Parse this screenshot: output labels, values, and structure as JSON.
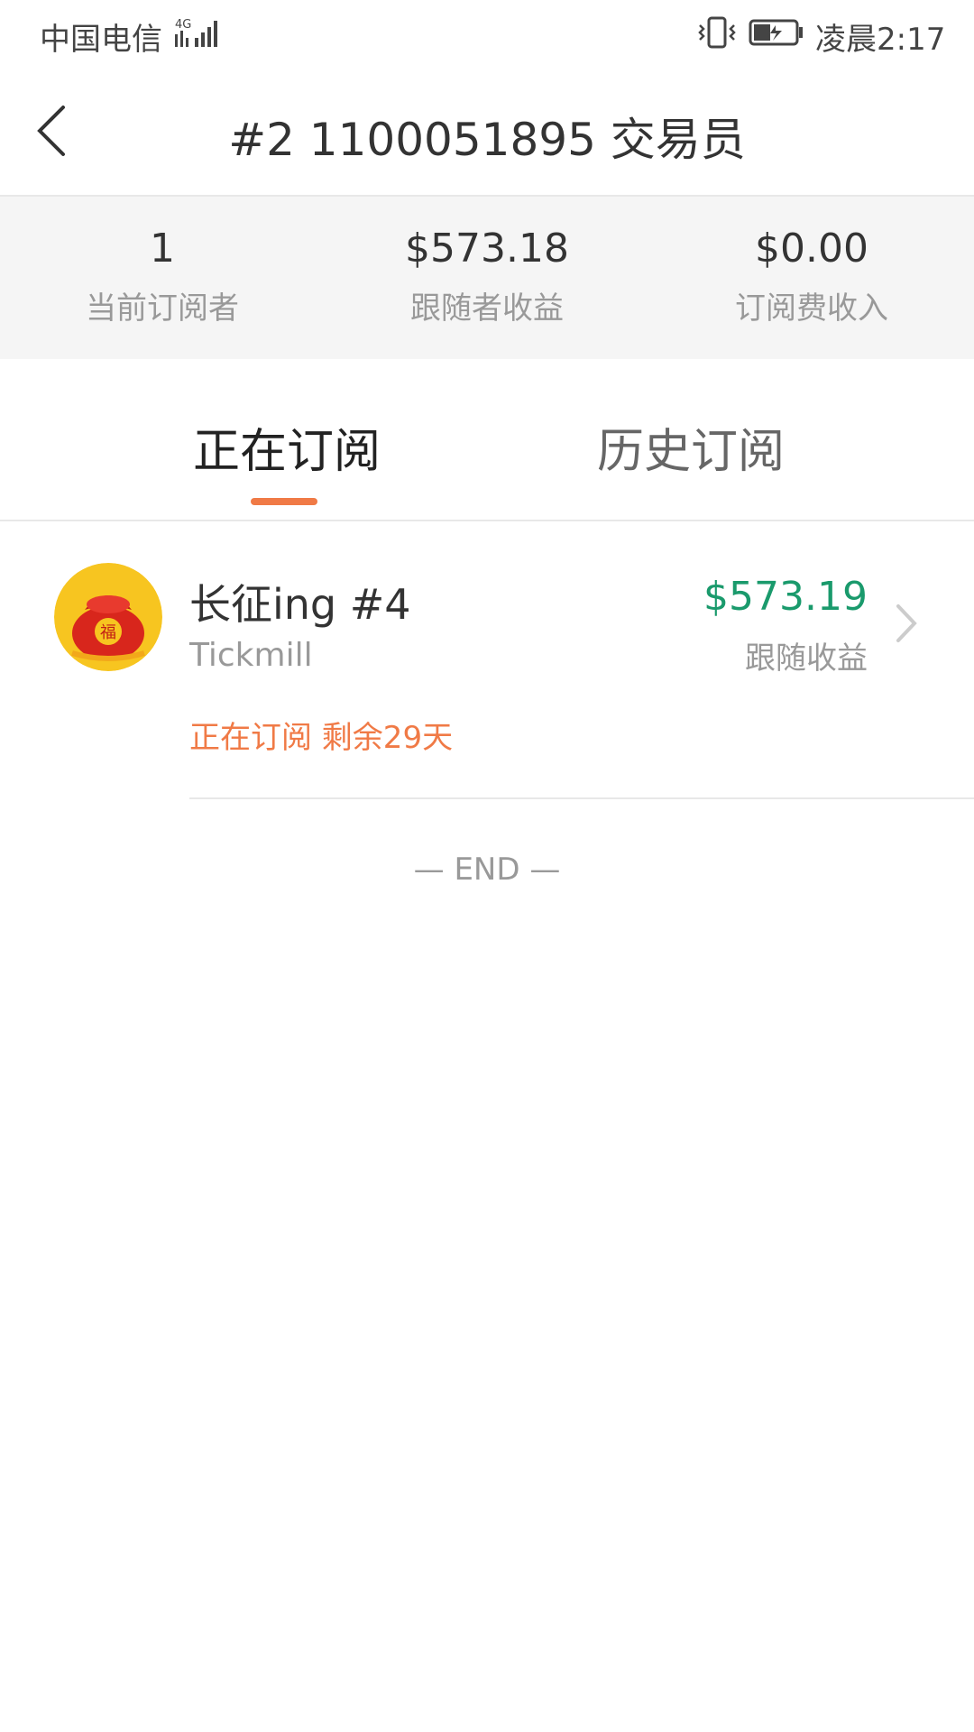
{
  "status_bar": {
    "carrier": "中国电信",
    "network_badge": "4G",
    "time": "凌晨2:17"
  },
  "nav": {
    "title": "#2 1100051895 交易员",
    "back_icon": "chevron-left-icon"
  },
  "stats": [
    {
      "value": "1",
      "label": "当前订阅者"
    },
    {
      "value": "$573.18",
      "label": "跟随者收益"
    },
    {
      "value": "$0.00",
      "label": "订阅费收入"
    }
  ],
  "tabs": [
    {
      "label": "正在订阅",
      "active": true
    },
    {
      "label": "历史订阅",
      "active": false
    }
  ],
  "subscriptions": [
    {
      "name": "长征ing #4",
      "broker": "Tickmill",
      "status": "正在订阅 剩余29天",
      "profit": "$573.19",
      "profit_label": "跟随收益"
    }
  ],
  "end_text": "— END —",
  "colors": {
    "accent": "#f07a46",
    "profit_green": "#1a9a6c",
    "stats_bg": "#f5f5f5"
  }
}
